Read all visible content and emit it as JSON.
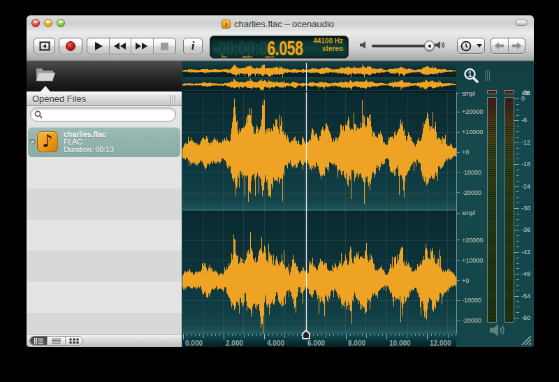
{
  "window": {
    "title": "charlies.flac – ocenaudio"
  },
  "titlebar": {
    "buttons": [
      "close",
      "minimize",
      "zoom"
    ],
    "toolbar_toggle": "lozenge"
  },
  "toolbar": {
    "sidebar_toggle_label": "toggle sidebar",
    "record_label": "record",
    "play_label": "play",
    "rewind_label": "rewind",
    "fast_forward_label": "fast forward",
    "stop_label": "stop",
    "info_label": "i",
    "lcd": {
      "ghost_digits": "-00:00:0",
      "time": "6.058",
      "unit_hr": "hr",
      "unit_min": "min",
      "unit_sec": "sec",
      "sample_rate": "44100 Hz",
      "channel_mode": "stereo"
    },
    "volume": {
      "value_percent": 88
    },
    "history": {
      "back": "back",
      "forward": "forward"
    }
  },
  "sidebar": {
    "panel_title": "Opened Files",
    "search_placeholder": "",
    "file": {
      "name": "charlies.flac",
      "format": "FLAC",
      "duration": "Duration: 00:13",
      "icon": "♪",
      "check": "✓"
    },
    "view_modes": [
      "detailed-list",
      "list",
      "grid"
    ]
  },
  "editor": {
    "amplitude_labels": [
      "smpl",
      "+20000",
      "+10000",
      "+0",
      "-10000",
      "-20000"
    ],
    "time_labels": [
      "0.000",
      "2.000",
      "4.000",
      "6.000",
      "8.000",
      "10.000",
      "12.000"
    ],
    "db_title": "dB",
    "db_labels": [
      "0",
      "-6",
      "-12",
      "-18",
      "-24",
      "-30",
      "-36",
      "-42",
      "-48",
      "-54",
      "-60"
    ],
    "playhead_seconds": 6.058,
    "duration_seconds": 13.0,
    "visible_seconds": 13.45,
    "colors": {
      "waveform": "#efa325",
      "background": "#0d363c",
      "grid": "rgba(190,150,140,0.15)",
      "selection": "#8fb0ac",
      "accent_orange": "#f3a51b"
    },
    "waveform_envelope": [
      [
        0.0,
        3.2
      ],
      [
        0.15,
        4.4
      ],
      [
        0.5,
        5.4
      ],
      [
        0.8,
        5.0
      ],
      [
        1.1,
        8.0
      ],
      [
        1.35,
        6.0
      ],
      [
        1.6,
        7.0
      ],
      [
        1.9,
        4.5
      ],
      [
        2.1,
        6.5
      ],
      [
        2.35,
        10.0
      ],
      [
        2.55,
        24.0
      ],
      [
        2.7,
        13.0
      ],
      [
        2.9,
        15.0
      ],
      [
        3.1,
        13.0
      ],
      [
        3.35,
        22.0
      ],
      [
        3.5,
        14.0
      ],
      [
        3.7,
        16.0
      ],
      [
        3.9,
        21.0
      ],
      [
        4.1,
        14.0
      ],
      [
        4.3,
        19.0
      ],
      [
        4.5,
        13.0
      ],
      [
        4.7,
        12.0
      ],
      [
        4.9,
        14.0
      ],
      [
        5.1,
        8.0
      ],
      [
        5.25,
        5.0
      ],
      [
        5.45,
        12.0
      ],
      [
        5.6,
        8.0
      ],
      [
        5.75,
        4.0
      ],
      [
        5.9,
        6.5
      ],
      [
        6.06,
        5.0
      ],
      [
        6.2,
        6.5
      ],
      [
        6.35,
        9.0
      ],
      [
        6.5,
        7.0
      ],
      [
        6.7,
        10.0
      ],
      [
        6.9,
        12.0
      ],
      [
        7.05,
        13.5
      ],
      [
        7.2,
        9.0
      ],
      [
        7.35,
        5.5
      ],
      [
        7.5,
        8.0
      ],
      [
        7.65,
        11.0
      ],
      [
        7.85,
        13.0
      ],
      [
        8.05,
        15.0
      ],
      [
        8.25,
        17.0
      ],
      [
        8.45,
        12.0
      ],
      [
        8.6,
        13.0
      ],
      [
        8.8,
        14.0
      ],
      [
        9.0,
        16.0
      ],
      [
        9.15,
        18.0
      ],
      [
        9.3,
        12.0
      ],
      [
        9.5,
        9.0
      ],
      [
        9.7,
        8.5
      ],
      [
        9.9,
        5.0
      ],
      [
        10.05,
        4.0
      ],
      [
        10.2,
        9.0
      ],
      [
        10.4,
        12.0
      ],
      [
        10.6,
        13.0
      ],
      [
        10.8,
        18.0
      ],
      [
        10.95,
        14.0
      ],
      [
        11.1,
        11.0
      ],
      [
        11.3,
        6.0
      ],
      [
        11.45,
        5.0
      ],
      [
        11.6,
        9.0
      ],
      [
        11.8,
        13.0
      ],
      [
        12.0,
        17.0
      ],
      [
        12.15,
        12.0
      ],
      [
        12.3,
        15.0
      ],
      [
        12.5,
        10.0
      ],
      [
        12.7,
        8.0
      ],
      [
        12.9,
        7.0
      ],
      [
        13.1,
        5.0
      ],
      [
        13.3,
        3.0
      ],
      [
        13.45,
        2.0
      ]
    ],
    "seed": 1337
  }
}
